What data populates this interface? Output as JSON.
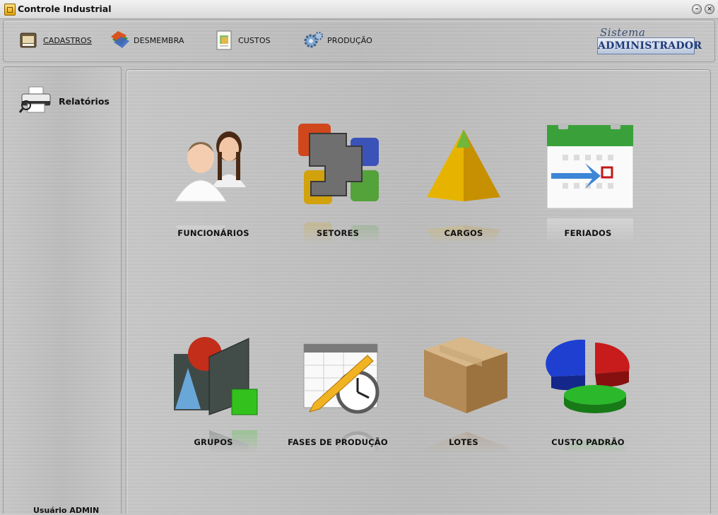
{
  "window": {
    "title": "Controle Industrial",
    "minimize_glyph": "–",
    "close_glyph": "×"
  },
  "toolbar": {
    "items": [
      {
        "label": "CADASTROS",
        "icon": "folder-icon",
        "underline": true
      },
      {
        "label": "DESMEMBRA",
        "icon": "layers-icon",
        "underline": false
      },
      {
        "label": "CUSTOS",
        "icon": "document-chart-icon",
        "underline": false
      },
      {
        "label": "PRODUÇÃO",
        "icon": "gears-icon",
        "underline": false
      }
    ],
    "brand": {
      "script": "Sistema",
      "name": "ADMINISTRADOR"
    }
  },
  "sidebar": {
    "items": [
      {
        "label": "Relatórios",
        "icon": "printer-icon"
      }
    ],
    "user_line": "Usuário ADMIN"
  },
  "main": {
    "tiles": [
      {
        "label": "FUNCIONÁRIOS",
        "icon": "users-icon"
      },
      {
        "label": "SETORES",
        "icon": "puzzle-icon"
      },
      {
        "label": "CARGOS",
        "icon": "pyramid-icon"
      },
      {
        "label": "FERIADOS",
        "icon": "calendar-icon"
      },
      {
        "label": "GRUPOS",
        "icon": "shapes-icon"
      },
      {
        "label": "FASES DE PRODUÇÃO",
        "icon": "schedule-clock-icon"
      },
      {
        "label": "LOTES",
        "icon": "box-icon"
      },
      {
        "label": "CUSTO PADRÃO",
        "icon": "pie-chart-icon"
      }
    ]
  },
  "colors": {
    "accent_blue": "#1e3a78",
    "panel": "#c2c2c2"
  }
}
